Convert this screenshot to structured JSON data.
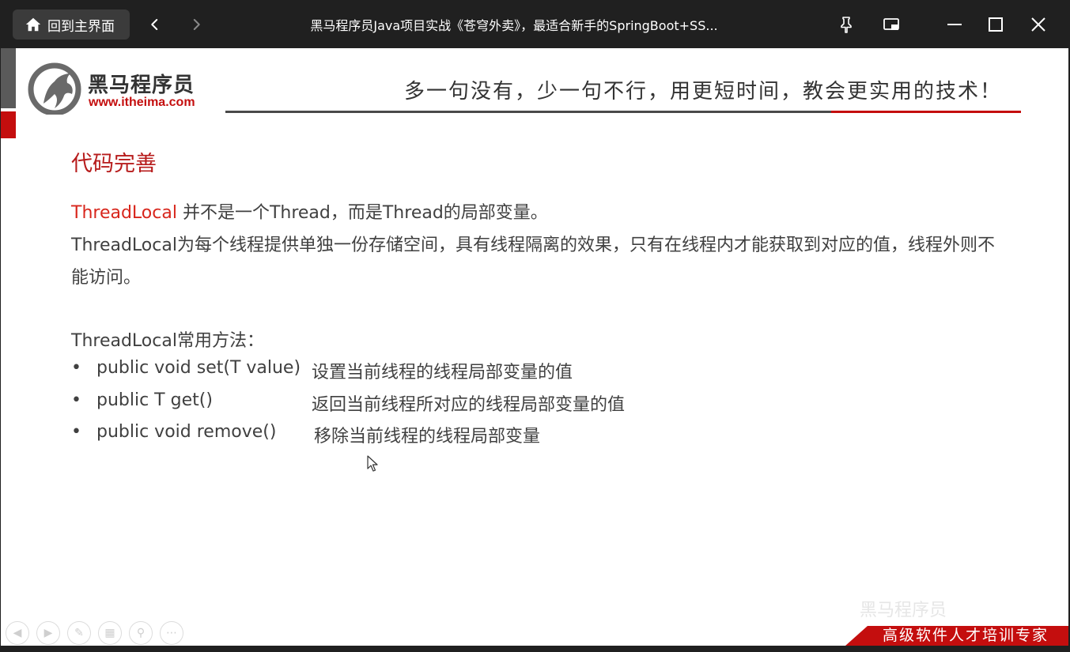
{
  "window": {
    "home_label": "回到主界面",
    "title": "黑马程序员Java项目实战《苍穹外卖》，最适合新手的SpringBoot+SS..."
  },
  "slide": {
    "logo": {
      "name_cn": "黑马程序员",
      "url": "www.itheima.com"
    },
    "slogan": "多一句没有，少一句不行，用更短时间，教会更实用的技术！",
    "heading": "代码完善",
    "para1": {
      "highlight": "ThreadLocal",
      "rest": " 并不是一个Thread，而是Thread的局部变量。"
    },
    "para2": {
      "line1": "ThreadLocal为每个线程提供单独一份存储空间，具有线程隔离的效果，只有在线程内才能获取到对应的值，线程外则不",
      "line2": "能访问。"
    },
    "methods_title": "ThreadLocal常用方法：",
    "bullet": "•",
    "methods": [
      {
        "signature": "public void set(T value)",
        "description": "设置当前线程的线程局部变量的值"
      },
      {
        "signature": "public T get()",
        "description": "返回当前线程所对应的线程局部变量的值"
      },
      {
        "signature": "public void remove()",
        "description": "移除当前线程的线程局部变量"
      }
    ],
    "footer_banner": "高级软件人才培训专家",
    "watermark": "黑马程序员"
  },
  "icons": {
    "home": "home-icon",
    "back": "chevron-left-icon",
    "forward": "chevron-right-icon",
    "pin": "pin-icon",
    "pip": "picture-in-picture-icon",
    "minimize": "minimize-icon",
    "maximize": "maximize-icon",
    "close": "close-icon",
    "ppt_prev": "prev-slide-icon",
    "ppt_next": "next-slide-icon",
    "ppt_pen": "pen-icon",
    "ppt_grid": "slides-grid-icon",
    "ppt_zoom": "zoom-icon",
    "ppt_more": "more-icon"
  },
  "colors": {
    "titlebar": "#202020",
    "accent_red": "#c40e0e",
    "text": "#404040"
  }
}
